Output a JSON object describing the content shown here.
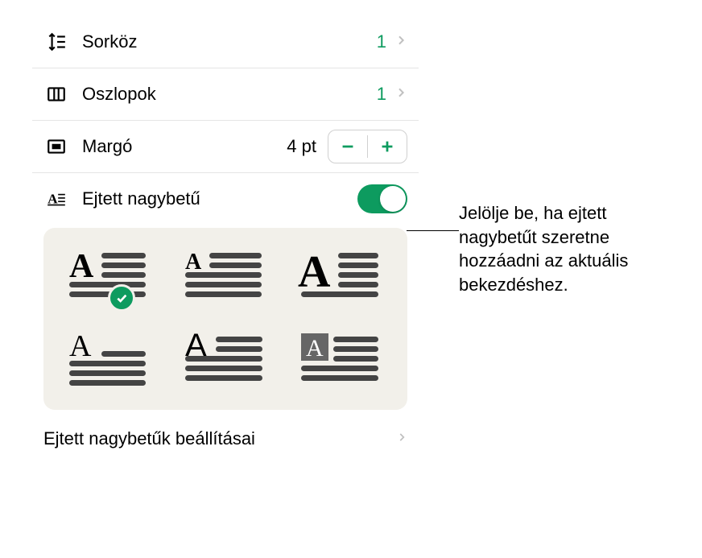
{
  "rows": {
    "lineSpacing": {
      "label": "Sorköz",
      "value": "1"
    },
    "columns": {
      "label": "Oszlopok",
      "value": "1"
    },
    "margin": {
      "label": "Margó",
      "value": "4 pt"
    },
    "dropCap": {
      "label": "Ejtett nagybetű"
    }
  },
  "settingsLink": "Ejtett nagybetűk beállításai",
  "callout": "Jelölje be, ha ejtett nagybetűt szeretne hozzáadni az aktuális bekezdéshez."
}
